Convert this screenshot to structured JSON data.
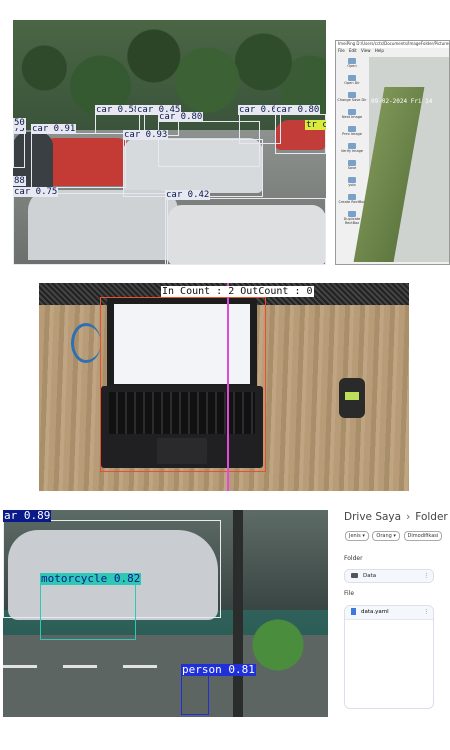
{
  "panel1": {
    "detections": [
      {
        "label": "75"
      },
      {
        "label": "car 0.91"
      },
      {
        "label": "car 0.58"
      },
      {
        "label": "car 0.45"
      },
      {
        "label": "car 0.80"
      },
      {
        "label": "car 0.6"
      },
      {
        "label": "car 0.80"
      },
      {
        "label": "car 0.93"
      },
      {
        "label": "car 0.75"
      },
      {
        "label": "car 0.42"
      },
      {
        "label": "88"
      },
      {
        "label": "50"
      },
      {
        "label": "tr car"
      }
    ],
    "app_window": {
      "title": "ImeiPing D:/Users/ccts/Documents/ImageFolder/Pictures/CCTV 03 (IP Camera)",
      "menu": [
        "File",
        "Edit",
        "View",
        "Help"
      ],
      "tools": [
        "Open",
        "Open Dir",
        "Change Save Dir",
        "Next Image",
        "Prev Image",
        "Verify Image",
        "Save",
        "yolo",
        "Create RectBox",
        "Duplicate RectBox"
      ],
      "timestamp": "09-02-2024 Fri 14"
    }
  },
  "panel2": {
    "count_label": "In Count : 2 OutCount : 0"
  },
  "panel3": {
    "detections": [
      {
        "label": "ar 0.89",
        "color": "#0b1a8a"
      },
      {
        "label": "motorcycle 0.82",
        "color": "#2ec9b6"
      },
      {
        "label": "person 0.81",
        "color": "#1f2fd9"
      }
    ]
  },
  "drive": {
    "breadcrumb": [
      "Drive Saya",
      "Folder Data"
    ],
    "filters": [
      "Jenis",
      "Orang",
      "Dimodifikasi"
    ],
    "folder_heading": "Folder",
    "folders": [
      {
        "name": "Data",
        "icon": "folder-icon"
      }
    ],
    "file_heading": "File",
    "files": [
      {
        "name": "data.yaml",
        "icon": "document-icon"
      }
    ],
    "more_glyph": "⋮",
    "chevron": "▾"
  }
}
